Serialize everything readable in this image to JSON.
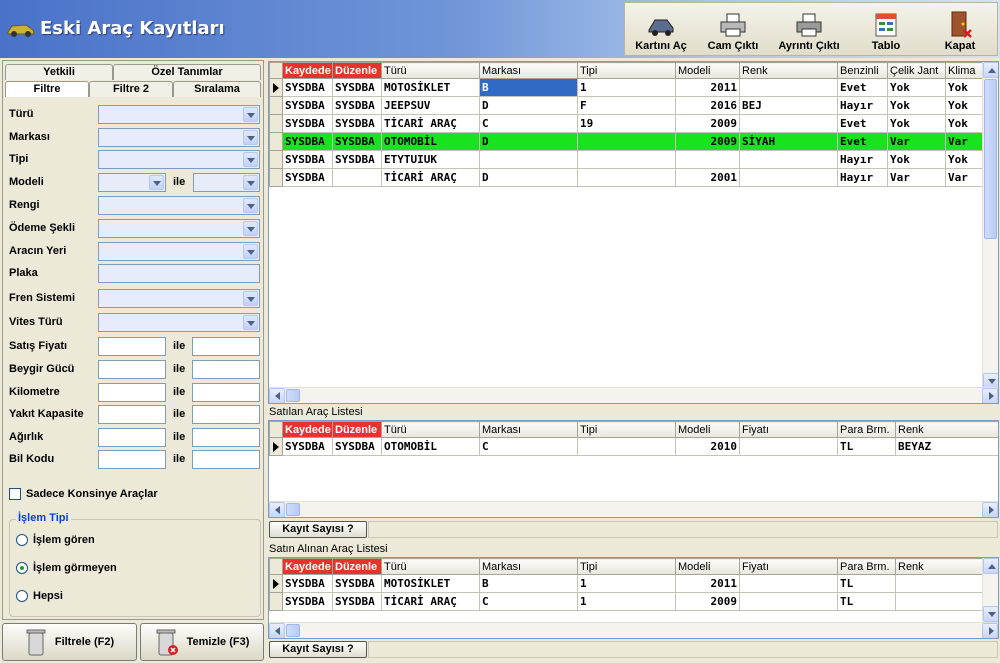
{
  "app": {
    "title": "Eski Araç Kayıtları"
  },
  "toolbar": [
    {
      "label": "Kartını Aç",
      "icon": "open-card-icon"
    },
    {
      "label": "Cam Çıktı",
      "icon": "printer-icon"
    },
    {
      "label": "Ayrıntı Çıktı",
      "icon": "printer-detail-icon"
    },
    {
      "label": "Tablo",
      "icon": "table-icon"
    },
    {
      "label": "Kapat",
      "icon": "exit-door-icon"
    }
  ],
  "left": {
    "tabs_top": [
      "Yetkili",
      "Özel Tanımlar"
    ],
    "tabs_bottom": [
      "Filtre",
      "Filtre 2",
      "Sıralama"
    ],
    "fields": {
      "turu": "Türü",
      "markasi": "Markası",
      "tipi": "Tipi",
      "modeli": "Modeli",
      "rengi": "Rengi",
      "odeme": "Ödeme Şekli",
      "yeri": "Aracın Yeri",
      "plaka": "Plaka",
      "fren": "Fren Sistemi",
      "vites": "Vites Türü",
      "fiyat": "Satış Fiyatı",
      "beygir": "Beygir Gücü",
      "km": "Kilometre",
      "yakit": "Yakıt Kapasite",
      "agirlik": "Ağırlık",
      "bil": "Bil Kodu"
    },
    "ile": "ile",
    "konsinye": "Sadece Konsinye Araçlar",
    "group_title": "İşlem Tipi",
    "radios": [
      "İşlem gören",
      "İşlem görmeyen",
      "Hepsi"
    ],
    "filter_btn": "Filtrele (F2)",
    "clear_btn": "Temizle (F3)"
  },
  "main_grid": {
    "columns": [
      "Kaydede",
      "Düzenle",
      "Türü",
      "Markası",
      "Tipi",
      "Modeli",
      "Renk",
      "Benzinli",
      "Çelik Jant",
      "Klima"
    ],
    "rows": [
      [
        "SYSDBA",
        "SYSDBA",
        "MOTOSİKLET",
        "B",
        "1",
        "2011",
        "",
        "Evet",
        "Yok",
        "Yok"
      ],
      [
        "SYSDBA",
        "SYSDBA",
        "JEEPSUV",
        "D",
        "F",
        "2016",
        "BEJ",
        "Hayır",
        "Yok",
        "Yok"
      ],
      [
        "SYSDBA",
        "SYSDBA",
        "TİCARİ ARAÇ",
        "C",
        "19",
        "2009",
        "",
        "Evet",
        "Yok",
        "Yok"
      ],
      [
        "SYSDBA",
        "SYSDBA",
        "OTOMOBİL",
        "D",
        "",
        "2009",
        "SİYAH",
        "Evet",
        "Var",
        "Var"
      ],
      [
        "SYSDBA",
        "SYSDBA",
        "ETYTUIUK",
        "",
        "",
        "",
        "",
        "Hayır",
        "Yok",
        "Yok"
      ],
      [
        "SYSDBA",
        "",
        "TİCARİ ARAÇ",
        "D",
        "",
        "2001",
        "",
        "Hayır",
        "Var",
        "Var"
      ]
    ]
  },
  "sold": {
    "title": "Satılan Araç Listesi",
    "columns": [
      "Kaydede",
      "Düzenle",
      "Türü",
      "Markası",
      "Tipi",
      "Modeli",
      "Fiyatı",
      "Para Brm.",
      "Renk"
    ],
    "rows": [
      [
        "SYSDBA",
        "SYSDBA",
        "OTOMOBİL",
        "C",
        "",
        "2010",
        "",
        "TL",
        "BEYAZ"
      ]
    ],
    "count_btn": "Kayıt Sayısı ?"
  },
  "bought": {
    "title": "Satın Alınan Araç Listesi",
    "columns": [
      "Kaydede",
      "Düzenle",
      "Türü",
      "Markası",
      "Tipi",
      "Modeli",
      "Fiyatı",
      "Para Brm.",
      "Renk"
    ],
    "rows": [
      [
        "SYSDBA",
        "SYSDBA",
        "MOTOSİKLET",
        "B",
        "1",
        "2011",
        "",
        "TL",
        ""
      ],
      [
        "SYSDBA",
        "SYSDBA",
        "TİCARİ ARAÇ",
        "C",
        "1",
        "2009",
        "",
        "TL",
        ""
      ]
    ],
    "count_btn": "Kayıt Sayısı ?"
  },
  "colors": {
    "highlight_row": "#17e41c",
    "header_red": "#e8322d",
    "selection": "#316ac5"
  }
}
